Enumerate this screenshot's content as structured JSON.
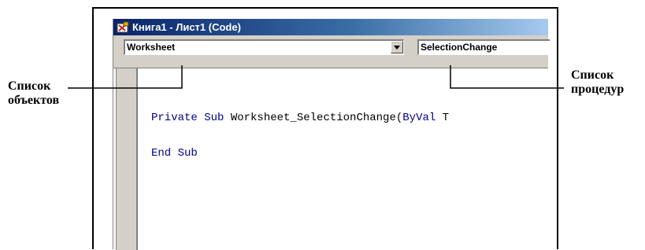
{
  "window": {
    "title": "Книга1 - Лист1 (Code)",
    "icon": "excel-vba-icon"
  },
  "object_combo": {
    "value": "Worksheet",
    "icon": "dropdown-arrow-icon"
  },
  "procedure_combo": {
    "value": "SelectionChange"
  },
  "code": {
    "line1": {
      "kw1": "Private Sub",
      "mid": " Worksheet_SelectionChange(",
      "kw2": "ByVal",
      "tail": " T"
    },
    "line2": {
      "kw": "End Sub"
    }
  },
  "annotations": {
    "objects_line1": "Список",
    "objects_line2": "объектов",
    "procs_line1": "Список",
    "procs_line2": "процедур"
  }
}
